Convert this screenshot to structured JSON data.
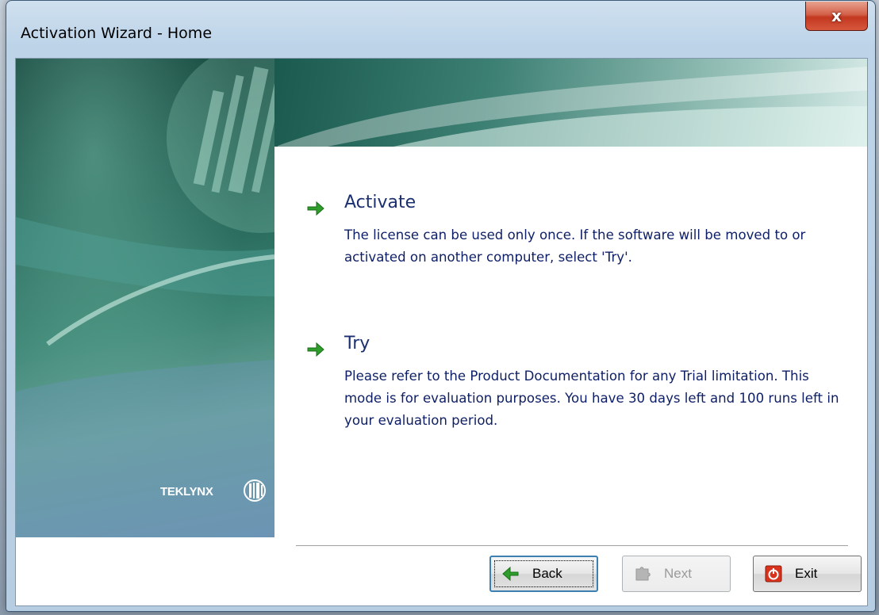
{
  "window": {
    "title": "Activation Wizard - Home",
    "close_glyph": "x"
  },
  "brand": {
    "logo_text": "TEKLYNX"
  },
  "options": [
    {
      "heading": "Activate",
      "description": "The license can be used only once. If the software will be moved to or activated on another computer, select 'Try'.",
      "icon": "green-arrow-right-icon"
    },
    {
      "heading": "Try",
      "description": "Please refer to the Product Documentation for any Trial limitation. This mode is for evaluation purposes. You have 30 days left and 100 runs left in your evaluation period.",
      "icon": "green-arrow-right-icon"
    }
  ],
  "buttons": {
    "back": {
      "label": "Back",
      "icon": "green-arrow-left-icon",
      "enabled": true
    },
    "next": {
      "label": "Next",
      "icon": "puzzle-icon",
      "enabled": false
    },
    "exit": {
      "label": "Exit",
      "icon": "power-icon",
      "enabled": true
    }
  },
  "colors": {
    "accent_green": "#2e9d2b",
    "heading_text": "#1c2f6e",
    "exit_red": "#d9331d"
  }
}
